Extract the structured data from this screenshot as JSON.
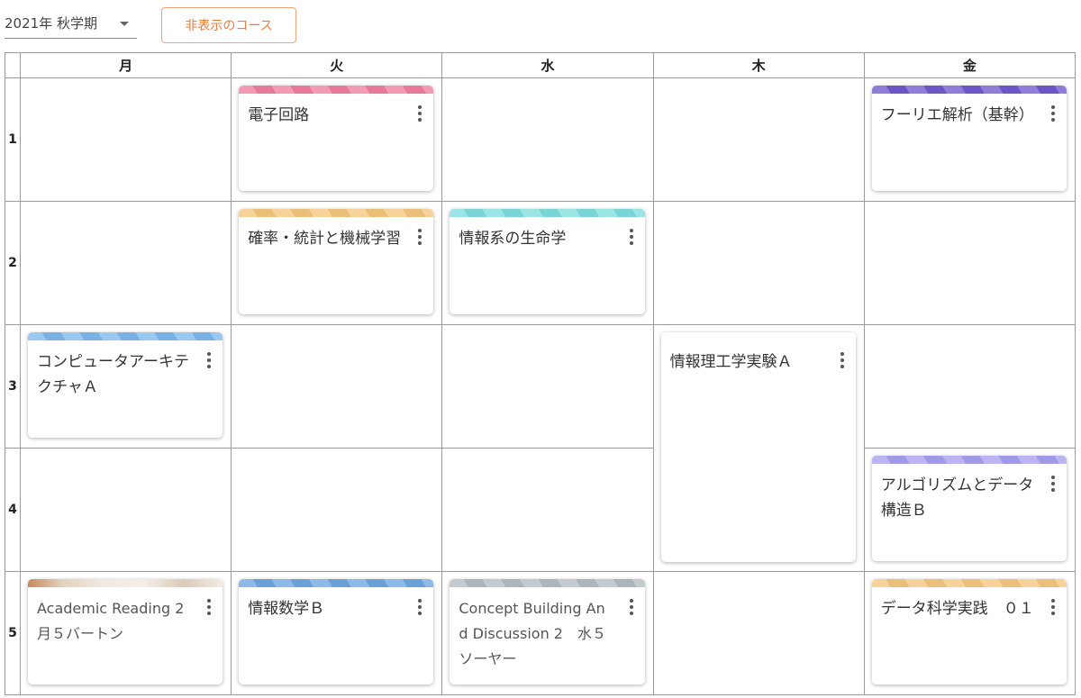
{
  "header": {
    "term": "2021年 秋学期",
    "hidden_courses_button": "非表示のコース"
  },
  "days": [
    "月",
    "火",
    "水",
    "木",
    "金"
  ],
  "periods": [
    "1",
    "2",
    "3",
    "4",
    "5"
  ],
  "courses": {
    "p1_tue": {
      "title": "電子回路",
      "color": "#f07fa0"
    },
    "p1_fri": {
      "title": "フーリエ解析（基幹）",
      "color": "#6e5acd"
    },
    "p2_tue": {
      "title": "確率・統計と機械学習",
      "color": "#f5c77e"
    },
    "p2_wed": {
      "title": "情報系の生命学",
      "color": "#7fdedf"
    },
    "p3_mon": {
      "title": "コンピュータアーキテクチャＡ",
      "color": "#7db8ef"
    },
    "p3_thu": {
      "title": "情報理工学実験Ａ",
      "color": "#ffffff"
    },
    "p4_fri": {
      "title": "アルゴリズムとデータ構造Ｂ",
      "color": "#a79ff0"
    },
    "p5_mon": {
      "title": "Academic Reading 2　月５バートン",
      "color": "#e4d2bd"
    },
    "p5_tue": {
      "title": "情報数学Ｂ",
      "color": "#6fa6e2"
    },
    "p5_wed": {
      "title": "Concept Building And Discussion 2　水５ソーヤー",
      "color": "#b4bcc2"
    },
    "p5_fri": {
      "title": "データ科学実践　０１",
      "color": "#f5c77e"
    }
  }
}
